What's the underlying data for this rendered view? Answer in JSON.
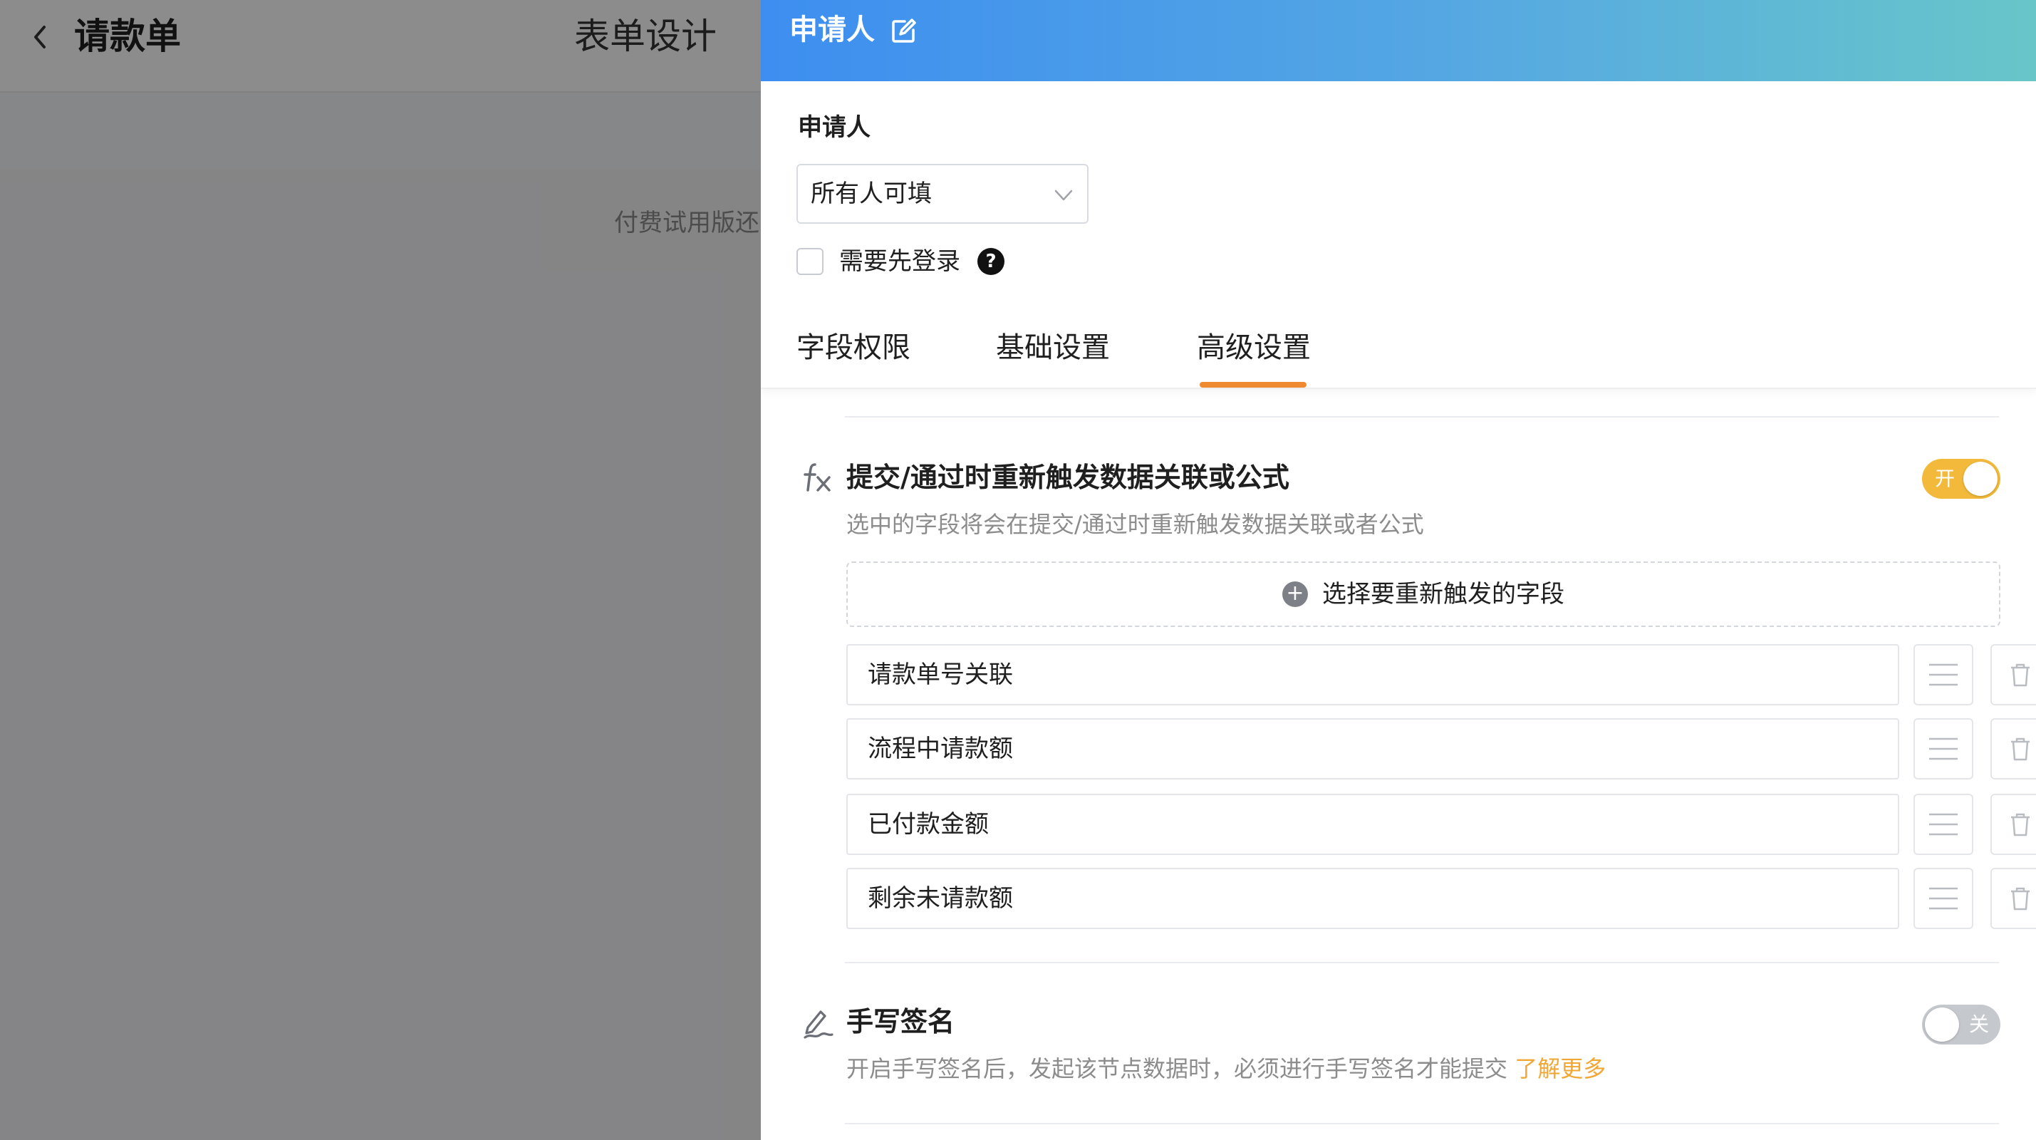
{
  "background": {
    "title": "请款单",
    "tab": "表单设计",
    "note": "付费试用版还"
  },
  "drawer": {
    "title": "申请人",
    "applicant_label": "申请人",
    "select_value": "所有人可填",
    "login_label": "需要先登录",
    "tabs": [
      {
        "label": "字段权限"
      },
      {
        "label": "基础设置"
      },
      {
        "label": "高级设置"
      }
    ],
    "active_tab": "高级设置",
    "accent_color": "#f08a30",
    "retrigger": {
      "icon": "function-fx-icon",
      "title": "提交/通过时重新触发数据关联或公式",
      "desc": "选中的字段将会在提交/通过时重新触发数据关联或者公式",
      "toggle_label": "开",
      "toggle_on": true,
      "add_label": "选择要重新触发的字段",
      "fields": [
        {
          "label": "请款单号关联"
        },
        {
          "label": "流程中请款额"
        },
        {
          "label": "已付款金额"
        },
        {
          "label": "剩余未请款额"
        }
      ]
    },
    "signature": {
      "icon": "handwriting-signature-icon",
      "title": "手写签名",
      "desc": "开启手写签名后，发起该节点数据时，必须进行手写签名才能提交",
      "learn_more": "了解更多",
      "toggle_label": "关",
      "toggle_on": false
    }
  }
}
